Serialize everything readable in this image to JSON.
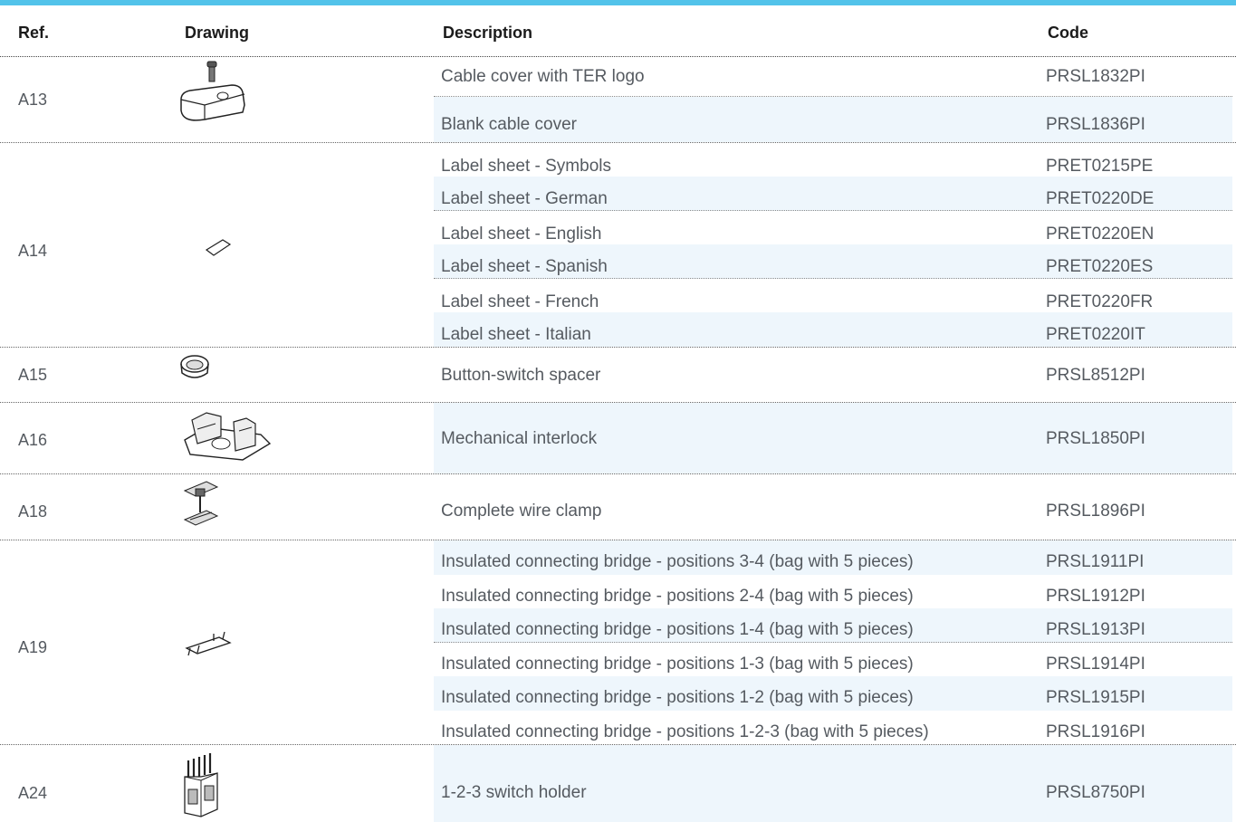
{
  "header": {
    "ref": "Ref.",
    "drawing": "Drawing",
    "description": "Description",
    "code": "Code"
  },
  "colors": {
    "accent_bar": "#52c3ea",
    "row_shade": "#eef6fc",
    "text": "#555a60"
  },
  "groups": [
    {
      "ref": "A13",
      "drawing_icon": "cable-cover-icon",
      "items": [
        {
          "description": "Cable cover with TER logo",
          "code": "PRSL1832PI"
        },
        {
          "description": "Blank cable cover",
          "code": "PRSL1836PI"
        }
      ]
    },
    {
      "ref": "A14",
      "drawing_icon": "label-sheet-icon",
      "items": [
        {
          "description": "Label sheet - Symbols",
          "code": "PRET0215PE"
        },
        {
          "description": "Label sheet - German",
          "code": "PRET0220DE"
        },
        {
          "description": "Label sheet - English",
          "code": "PRET0220EN"
        },
        {
          "description": "Label sheet - Spanish",
          "code": "PRET0220ES"
        },
        {
          "description": "Label sheet - French",
          "code": "PRET0220FR"
        },
        {
          "description": "Label sheet - Italian",
          "code": "PRET0220IT"
        }
      ]
    },
    {
      "ref": "A15",
      "drawing_icon": "spacer-ring-icon",
      "items": [
        {
          "description": "Button-switch spacer",
          "code": "PRSL8512PI"
        }
      ]
    },
    {
      "ref": "A16",
      "drawing_icon": "mechanical-interlock-icon",
      "items": [
        {
          "description": "Mechanical interlock",
          "code": "PRSL1850PI"
        }
      ]
    },
    {
      "ref": "A18",
      "drawing_icon": "wire-clamp-icon",
      "items": [
        {
          "description": "Complete wire clamp",
          "code": "PRSL1896PI"
        }
      ]
    },
    {
      "ref": "A19",
      "drawing_icon": "connecting-bridge-icon",
      "items": [
        {
          "description": "Insulated connecting bridge - positions 3-4 (bag with 5 pieces)",
          "code": "PRSL1911PI"
        },
        {
          "description": "Insulated connecting bridge - positions 2-4 (bag with 5 pieces)",
          "code": "PRSL1912PI"
        },
        {
          "description": "Insulated connecting bridge - positions 1-4 (bag with 5 pieces)",
          "code": "PRSL1913PI"
        },
        {
          "description": "Insulated connecting bridge - positions 1-3 (bag with 5 pieces)",
          "code": "PRSL1914PI"
        },
        {
          "description": "Insulated connecting bridge - positions 1-2 (bag with 5 pieces)",
          "code": "PRSL1915PI"
        },
        {
          "description": "Insulated connecting bridge - positions 1-2-3 (bag with 5 pieces)",
          "code": "PRSL1916PI"
        }
      ]
    },
    {
      "ref": "A24",
      "drawing_icon": "switch-holder-icon",
      "items": [
        {
          "description": "1-2-3 switch holder",
          "code": "PRSL8750PI"
        }
      ]
    }
  ]
}
